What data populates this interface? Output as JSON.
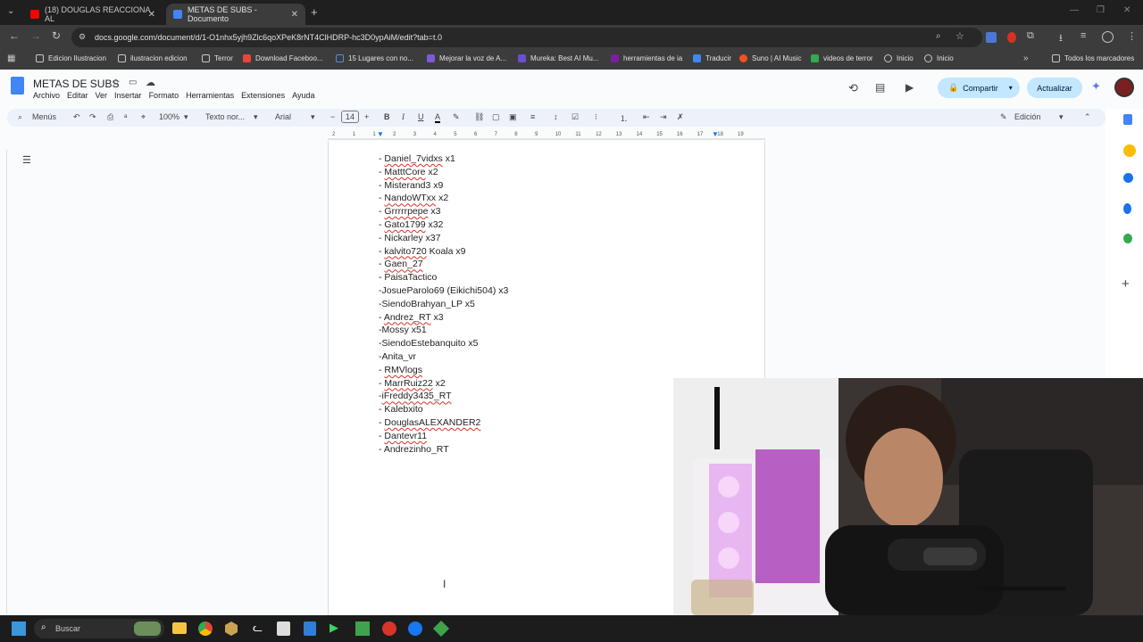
{
  "browser": {
    "tabs": [
      {
        "title": "(18) DOUGLAS REACCIONA AL",
        "active": false,
        "favicon_color": "#ff0000"
      },
      {
        "title": "METAS DE SUBS - Documento",
        "active": true,
        "favicon_color": "#4285f4"
      }
    ],
    "url": "docs.google.com/document/d/1-O1nhx5yjh9Zlc6qoXPeK8rNT4ClHDRP-hc3D0ypAiM/edit?tab=t.0",
    "bookmarks": [
      "Edicion Ilustracion",
      "ilustracion edicion",
      "Terror",
      "Download Faceboo...",
      "15 Lugares con no...",
      "Mejorar la voz de A...",
      "Mureka: Best AI Mu...",
      "herramientas de ia",
      "Traducir",
      "Suno | AI Music",
      "videos de terror",
      "Inicio",
      "Inicio"
    ],
    "all_bookmarks": "Todos los marcadores"
  },
  "doc": {
    "title": "METAS DE SUBS",
    "menu": [
      "Archivo",
      "Editar",
      "Ver",
      "Insertar",
      "Formato",
      "Herramientas",
      "Extensiones",
      "Ayuda"
    ],
    "share_label": "Compartir",
    "update_label": "Actualizar",
    "menus_search": "Menús",
    "zoom": "100%",
    "style": "Texto nor...",
    "font": "Arial",
    "font_size": "14",
    "mode": "Edición",
    "ruler_marks": [
      "2",
      "1",
      "1",
      "2",
      "3",
      "4",
      "5",
      "6",
      "7",
      "8",
      "9",
      "10",
      "11",
      "12",
      "13",
      "14",
      "15",
      "16",
      "17",
      "18",
      "19"
    ],
    "lines": [
      {
        "prefix": "- ",
        "name": "Daniel_7vidxs",
        "suffix": " x1",
        "squiggle": true
      },
      {
        "prefix": "- ",
        "name": "MatttCore",
        "suffix": " x2",
        "squiggle": true
      },
      {
        "prefix": "- ",
        "name": "Misterand3",
        "suffix": " x9",
        "squiggle": false
      },
      {
        "prefix": "- ",
        "name": "NandoWTxx",
        "suffix": " x2",
        "squiggle": true
      },
      {
        "prefix": "- ",
        "name": "Grrrrrpepe",
        "suffix": " x3",
        "squiggle": true
      },
      {
        "prefix": "- ",
        "name": "Gato1799",
        "suffix": " x32",
        "squiggle": true
      },
      {
        "prefix": "- ",
        "name": "Nickarley",
        "suffix": " x37",
        "squiggle": false
      },
      {
        "prefix": "- ",
        "name": "kalvito720",
        "suffix": " Koala x9",
        "squiggle": true
      },
      {
        "prefix": "- ",
        "name": "Gaen_27",
        "suffix": "",
        "squiggle": true
      },
      {
        "prefix": "- ",
        "name": "PaisaTactico",
        "suffix": "",
        "squiggle": false
      },
      {
        "prefix": "-",
        "name": "JosueParolo69 (Eikichi504)",
        "suffix": " x3",
        "squiggle": false
      },
      {
        "prefix": "-",
        "name": "SiendoBrahyan_LP",
        "suffix": " x5",
        "squiggle": false
      },
      {
        "prefix": "- ",
        "name": "Andrez_RT",
        "suffix": " x3",
        "squiggle": true
      },
      {
        "prefix": "-",
        "name": "Mossy",
        "suffix": " x51",
        "squiggle": false
      },
      {
        "prefix": "-",
        "name": "SiendoEstebanquito",
        "suffix": " x5",
        "squiggle": false
      },
      {
        "prefix": "-",
        "name": "Anita_vr",
        "suffix": "",
        "squiggle": false
      },
      {
        "prefix": "- ",
        "name": "RMVlogs",
        "suffix": "",
        "squiggle": true
      },
      {
        "prefix": "- ",
        "name": "MarrRuiz22",
        "suffix": " x2",
        "squiggle": true
      },
      {
        "prefix": "-",
        "name": "iFreddy3435_RT",
        "suffix": "",
        "squiggle": true
      },
      {
        "prefix": "- ",
        "name": "Kalebxito",
        "suffix": "",
        "squiggle": false
      },
      {
        "prefix": "- ",
        "name": "DouglasALEXANDER2",
        "suffix": "",
        "squiggle": true
      },
      {
        "prefix": "- ",
        "name": "Dantevr11",
        "suffix": "",
        "squiggle": true
      },
      {
        "prefix": "- ",
        "name": "Andrezinho_RT",
        "suffix": "",
        "squiggle": false
      }
    ]
  },
  "taskbar": {
    "search_placeholder": "Buscar"
  }
}
